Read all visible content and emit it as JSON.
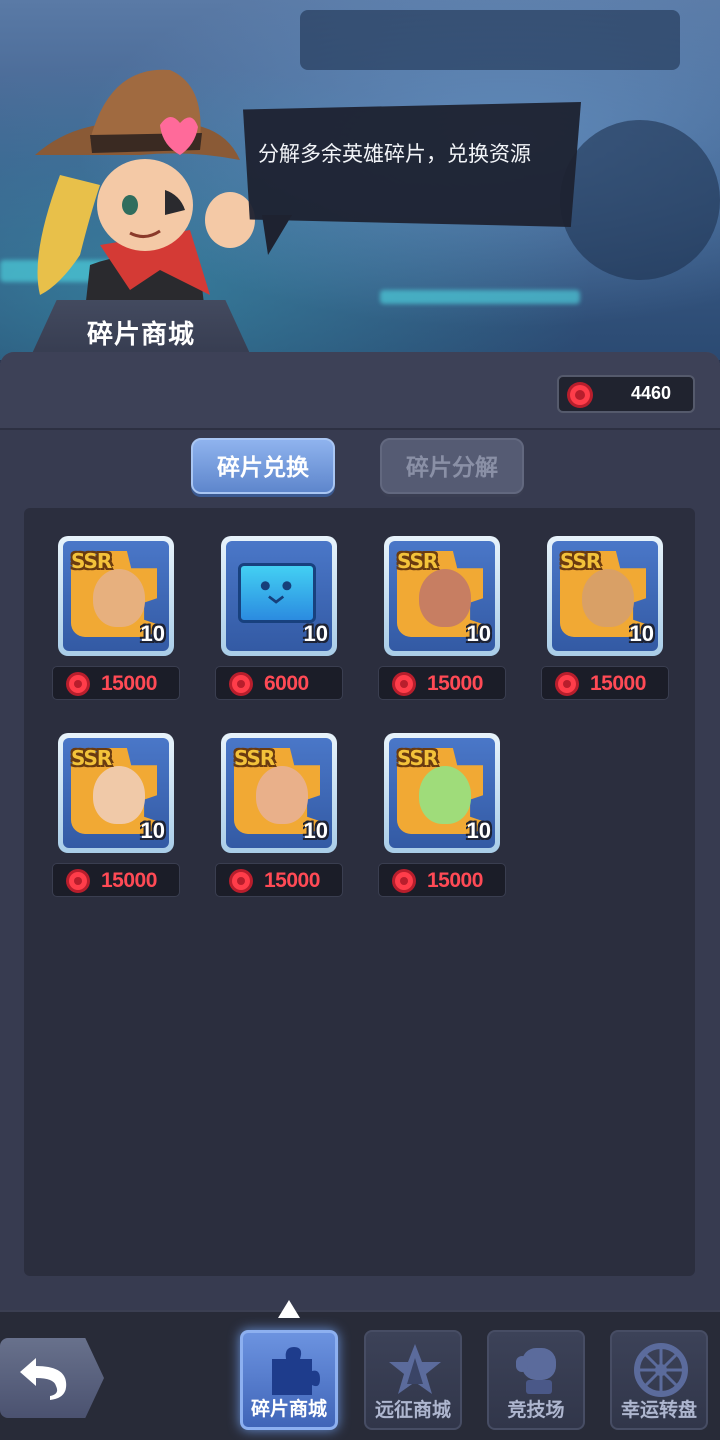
{
  "header": {
    "title": "碎片商城",
    "speech": "分解多余英雄碎片，兑换资源"
  },
  "currency": {
    "icon": "red-gear-token-icon",
    "amount": "4460"
  },
  "tabs": [
    {
      "label": "碎片兑换",
      "active": true
    },
    {
      "label": "碎片分解",
      "active": false
    }
  ],
  "items": [
    {
      "badge": "SSR",
      "quantity": "10",
      "price": "15000",
      "hero": "mustache-gunslinger",
      "color": "#e7b07e"
    },
    {
      "badge": "",
      "quantity": "10",
      "price": "6000",
      "hero": "blue-fragment-block",
      "color": "#3aaef0"
    },
    {
      "badge": "SSR",
      "quantity": "10",
      "price": "15000",
      "hero": "bearded-dj",
      "color": "#c77e62"
    },
    {
      "badge": "SSR",
      "quantity": "10",
      "price": "15000",
      "hero": "monkey-girl",
      "color": "#d9a066"
    },
    {
      "badge": "SSR",
      "quantity": "10",
      "price": "15000",
      "hero": "wizard-hat-hero",
      "color": "#f0c9a8"
    },
    {
      "badge": "SSR",
      "quantity": "10",
      "price": "15000",
      "hero": "bandana-fighter",
      "color": "#e9b08a"
    },
    {
      "badge": "SSR",
      "quantity": "10",
      "price": "15000",
      "hero": "green-hair-girl",
      "color": "#9fdc7a"
    }
  ],
  "bottom_nav": {
    "back_icon": "back-arrow-icon",
    "items": [
      {
        "label": "碎片商城",
        "icon": "puzzle-piece-icon",
        "active": true
      },
      {
        "label": "远征商城",
        "icon": "expedition-star-icon",
        "active": false
      },
      {
        "label": "竞技场",
        "icon": "boxing-glove-icon",
        "active": false
      },
      {
        "label": "幸运转盘",
        "icon": "wheel-icon",
        "active": false
      }
    ]
  },
  "colors": {
    "accent": "#5e86cc",
    "price": "#ff4a55",
    "panel": "#373b50"
  }
}
